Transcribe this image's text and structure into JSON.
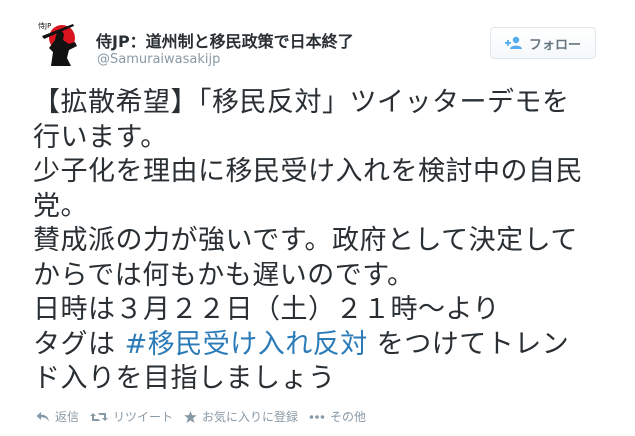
{
  "author": {
    "display_name": "侍JP：道州制と移民政策で日本終了",
    "handle": "@Samuraiwasakijp",
    "avatar_icon": "samurai-silhouette-icon"
  },
  "follow_button": {
    "label": "フォロー",
    "icon": "add-user-icon"
  },
  "tweet": {
    "lines": [
      "【拡散希望】「移民反対」ツイッターデモを",
      "行います。",
      "少子化を理由に移民受け入れを検討中の自民",
      "党。",
      "賛成派の力が強いです。政府として決定して",
      "からでは何もかも遅いのです。",
      "日時は３月２２日（土）２１時〜より"
    ],
    "tag_line_prefix": "タグは ",
    "hashtag": "#移民受け入れ反対",
    "tag_line_suffix": " をつけてトレン",
    "last_line": "ド入りを目指しましょう"
  },
  "actions": [
    {
      "label": "返信",
      "icon": "reply-icon"
    },
    {
      "label": "リツイート",
      "icon": "retweet-icon"
    },
    {
      "label": "お気に入りに登録",
      "icon": "star-icon"
    },
    {
      "label": "その他",
      "icon": "more-icon"
    }
  ],
  "colors": {
    "text": "#292f33",
    "secondary": "#8899a6",
    "link": "#2b7bb9",
    "follow_border": "#e1e8ed",
    "avatar_red": "#d8141e"
  }
}
